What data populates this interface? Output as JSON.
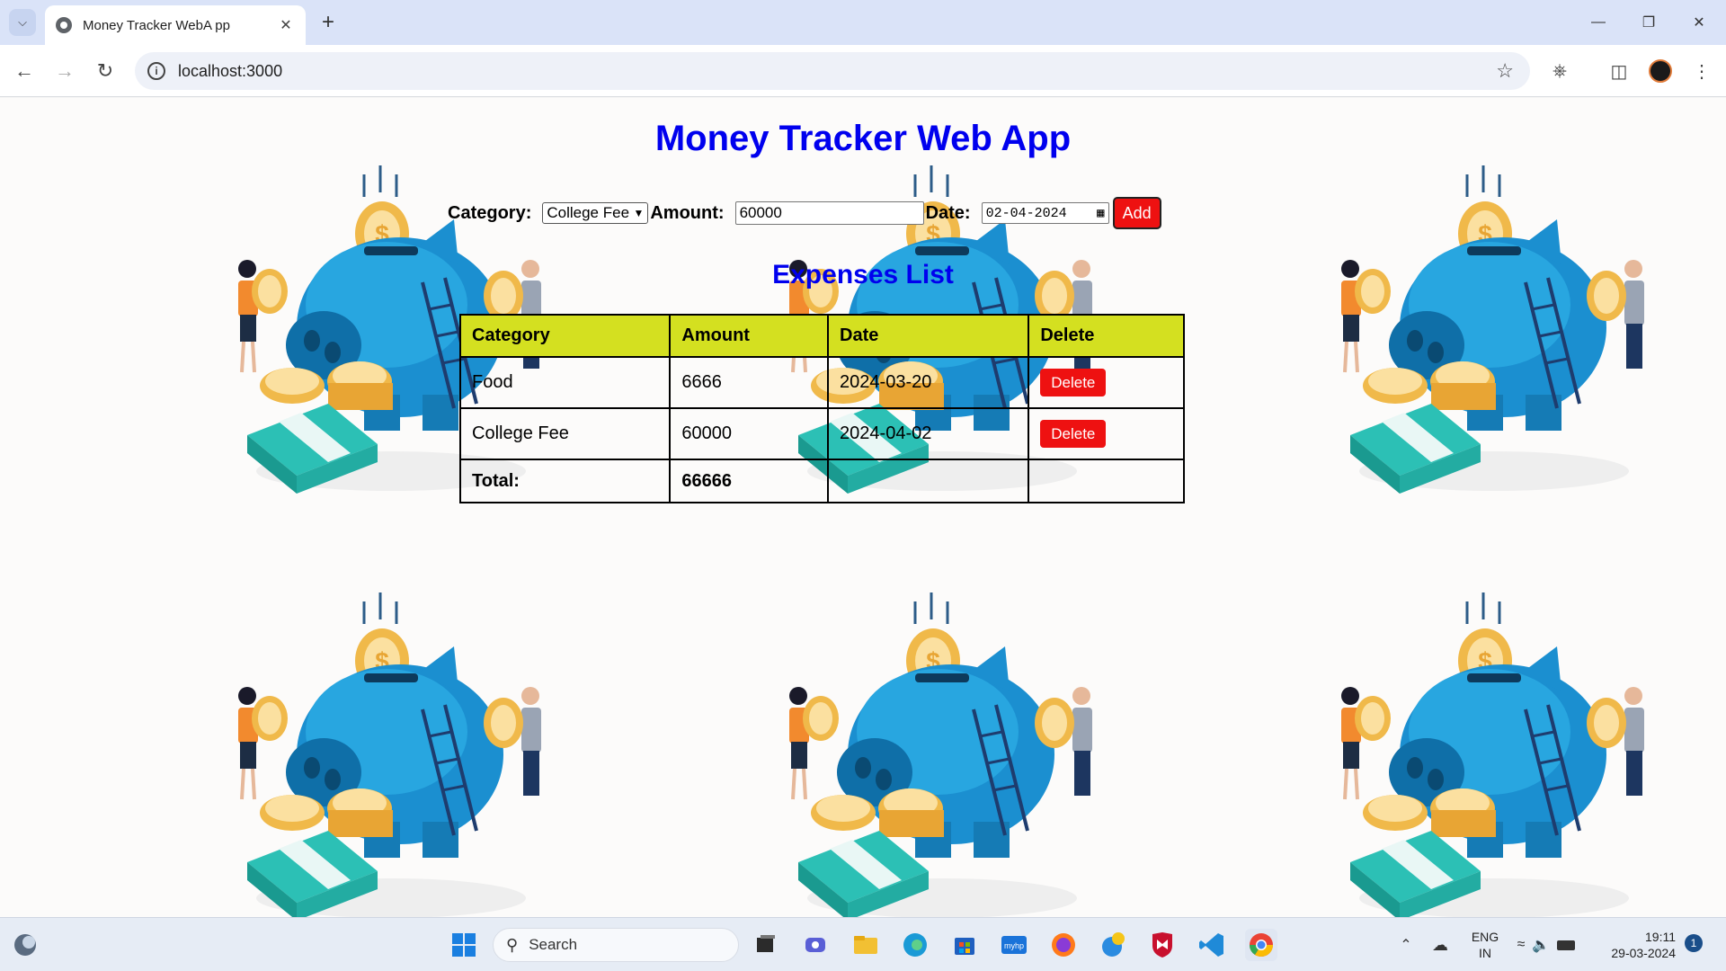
{
  "browser": {
    "tab_title": "Money Tracker WebA pp",
    "url": "localhost:3000"
  },
  "app": {
    "title": "Money Tracker Web App",
    "form": {
      "category_label": "Category:",
      "category_value": "College Fee",
      "amount_label": "Amount:",
      "amount_value": "60000",
      "date_label": "Date:",
      "date_value": "02-04-2024",
      "add_label": "Add"
    },
    "list_title": "Expenses List",
    "table": {
      "headers": [
        "Category",
        "Amount",
        "Date",
        "Delete"
      ],
      "rows": [
        {
          "category": "Food",
          "amount": "6666",
          "date": "2024-03-20",
          "delete_label": "Delete"
        },
        {
          "category": "College Fee",
          "amount": "60000",
          "date": "2024-04-02",
          "delete_label": "Delete"
        }
      ],
      "total_label": "Total:",
      "total_value": "66666"
    }
  },
  "taskbar": {
    "search_placeholder": "Search",
    "lang_line1": "ENG",
    "lang_line2": "IN",
    "time": "19:11",
    "date": "29-03-2024",
    "notification_count": "1"
  },
  "colors": {
    "title_blue": "#0000ee",
    "header_yellow": "#d4e020",
    "button_red": "#ee1111"
  }
}
